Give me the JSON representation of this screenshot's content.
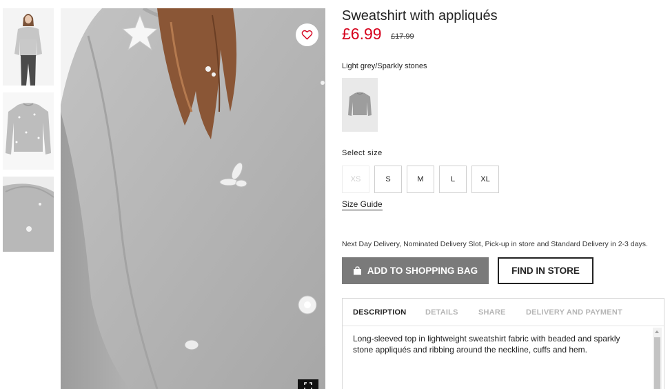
{
  "product": {
    "title": "Sweatshirt with appliqués",
    "price": "£6.99",
    "old_price": "£17.99",
    "color_name": "Light grey/Sparkly stones"
  },
  "gallery": {
    "thumbnails": [
      "model-full-view",
      "flat-lay-front",
      "detail-shoulder"
    ],
    "favourite_icon": "heart-icon",
    "expand_icon": "expand-icon"
  },
  "sizes": {
    "heading": "Select size",
    "options": [
      {
        "label": "XS",
        "available": false
      },
      {
        "label": "S",
        "available": true
      },
      {
        "label": "M",
        "available": true
      },
      {
        "label": "L",
        "available": true
      },
      {
        "label": "XL",
        "available": true
      }
    ],
    "guide_label": "Size Guide"
  },
  "delivery_note": "Next Day Delivery, Nominated Delivery Slot, Pick-up in store and Standard Delivery in 2-3 days.",
  "actions": {
    "add_to_bag": "ADD TO SHOPPING BAG",
    "add_to_bag_icon": "shopping-bag-icon",
    "find_in_store": "FIND IN STORE"
  },
  "tabs": {
    "items": [
      "DESCRIPTION",
      "DETAILS",
      "SHARE",
      "DELIVERY AND PAYMENT"
    ],
    "active": "DESCRIPTION"
  },
  "description": "Long-sleeved top in lightweight sweatshirt fabric with beaded and sparkly stone appliqués and ribbing around the neckline, cuffs and hem.",
  "colors": {
    "price_red": "#d6001c",
    "button_grey": "#7a7a7a"
  }
}
